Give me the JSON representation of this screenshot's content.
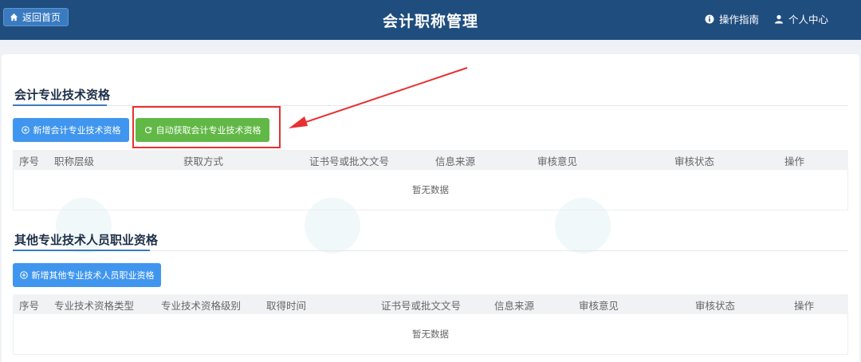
{
  "header": {
    "home_label": "返回首页",
    "title": "会计职称管理",
    "guide_label": "操作指南",
    "user_label": "个人中心"
  },
  "section1": {
    "title": "会计专业技术资格",
    "add_label": "新增会计专业技术资格",
    "auto_label": "自动获取会计专业技术资格",
    "columns": [
      "序号",
      "职称层级",
      "获取方式",
      "证书号或批文文号",
      "信息来源",
      "审核意见",
      "审核状态",
      "操作"
    ],
    "empty_text": "暂无数据"
  },
  "section2": {
    "title": "其他专业技术人员职业资格",
    "add_label": "新增其他专业技术人员职业资格",
    "columns": [
      "序号",
      "专业技术资格类型",
      "专业技术资格级别",
      "取得时间",
      "证书号或批文文号",
      "信息来源",
      "审核意见",
      "审核状态",
      "操作"
    ],
    "empty_text": "暂无数据"
  },
  "colors": {
    "header_bg": "#1f4d7e",
    "primary_blue": "#4096ee",
    "success_green": "#62b846",
    "annotation_red": "#e83030"
  }
}
